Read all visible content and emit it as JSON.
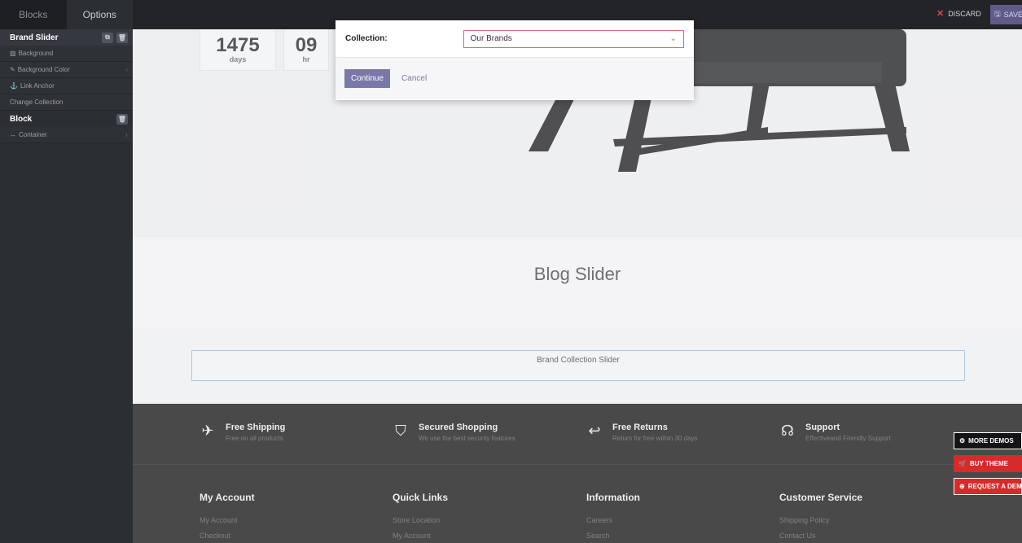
{
  "editor": {
    "tabs": [
      "Blocks",
      "Options"
    ],
    "discard_label": "DISCARD",
    "save_label": "SAVE"
  },
  "sidebar": {
    "brand_slider_title": "Brand Slider",
    "items": [
      {
        "label": "Background",
        "icon": "image-icon"
      },
      {
        "label": "Background Color",
        "icon": "paint-brush-icon"
      },
      {
        "label": "Link Anchor",
        "icon": "anchor-icon"
      },
      {
        "label": "Change Collection",
        "icon": ""
      }
    ],
    "block_title": "Block",
    "container_label": "Container"
  },
  "countdown": [
    {
      "value": "1475",
      "unit": "days"
    },
    {
      "value": "09",
      "unit": "hr"
    }
  ],
  "page": {
    "blog_title": "Blog Slider",
    "brand_collection_label": "Brand Collection Slider"
  },
  "modal": {
    "label": "Collection:",
    "selected": "Our Brands",
    "continue_label": "Continue",
    "cancel_label": "Cancel"
  },
  "footer": {
    "features": [
      {
        "title": "Free Shipping",
        "subtitle": "Free on all products",
        "icon": "airplane-icon"
      },
      {
        "title": "Secured Shopping",
        "subtitle": "We use the best security features",
        "icon": "shield-icon"
      },
      {
        "title": "Free Returns",
        "subtitle": "Return for free within 30 days",
        "icon": "return-arrow-icon"
      },
      {
        "title": "Support",
        "subtitle": "Effectiveand Friendly Support",
        "icon": "headset-icon"
      }
    ],
    "columns": [
      {
        "title": "My Account",
        "links": [
          "My Account",
          "Checkout"
        ]
      },
      {
        "title": "Quick Links",
        "links": [
          "Store Location",
          "My Account"
        ]
      },
      {
        "title": "Information",
        "links": [
          "Careers",
          "Search"
        ]
      },
      {
        "title": "Customer Service",
        "links": [
          "Shipping Policy",
          "Contact Us"
        ]
      }
    ]
  },
  "floating": {
    "more_demos": "MORE DEMOS",
    "buy_theme": "BUY THEME",
    "request_demo": "REQUEST A DEMO"
  },
  "colors": {
    "accent": "#7a77a9",
    "danger": "#d72a2a"
  }
}
